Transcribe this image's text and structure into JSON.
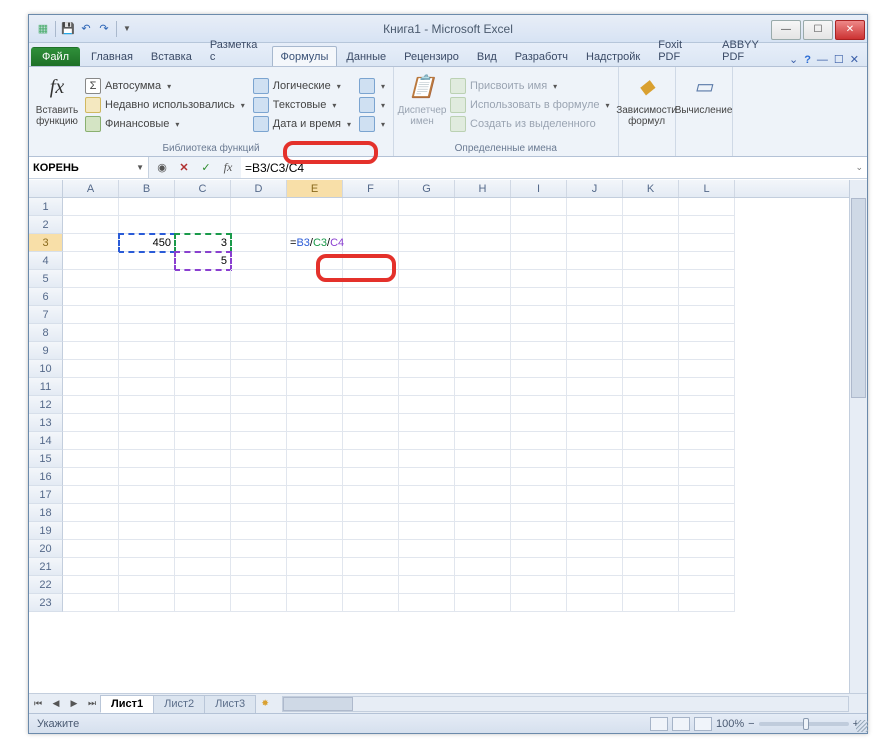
{
  "title": "Книга1 - Microsoft Excel",
  "tabs": {
    "file": "Файл",
    "items": [
      "Главная",
      "Вставка",
      "Разметка с",
      "Формулы",
      "Данные",
      "Рецензиро",
      "Вид",
      "Разработч",
      "Надстройк",
      "Foxit PDF",
      "ABBYY PDF"
    ],
    "active": "Формулы"
  },
  "ribbon": {
    "insertfn": {
      "big": "Вставить\nфункцию",
      "fx": "fx"
    },
    "lib": {
      "autosum": "Автосумма",
      "recent": "Недавно использовались",
      "financial": "Финансовые",
      "logical": "Логические",
      "text": "Текстовые",
      "datetime": "Дата и время",
      "label": "Библиотека функций"
    },
    "names": {
      "manager": "Диспетчер\nимен",
      "assign": "Присвоить имя",
      "usein": "Использовать в формуле",
      "createfrom": "Создать из выделенного",
      "label": "Определенные имена"
    },
    "deps": {
      "label": "Зависимости\nформул"
    },
    "calc": {
      "label": "Вычисление"
    }
  },
  "namebox": "КОРЕНЬ",
  "formula": "=B3/C3/C4",
  "formula_parts": {
    "pre": "=",
    "b": "B3",
    "s1": "/",
    "g": "C3",
    "s2": "/",
    "p": "C4"
  },
  "cells": {
    "B3": "450",
    "C3": "3",
    "C4": "5"
  },
  "cols": [
    "A",
    "B",
    "C",
    "D",
    "E",
    "F",
    "G",
    "H",
    "I",
    "J",
    "K",
    "L"
  ],
  "rowcount": 23,
  "active_col": "E",
  "active_row": 3,
  "sheets": [
    "Лист1",
    "Лист2",
    "Лист3"
  ],
  "status": "Укажите",
  "zoom": "100%"
}
